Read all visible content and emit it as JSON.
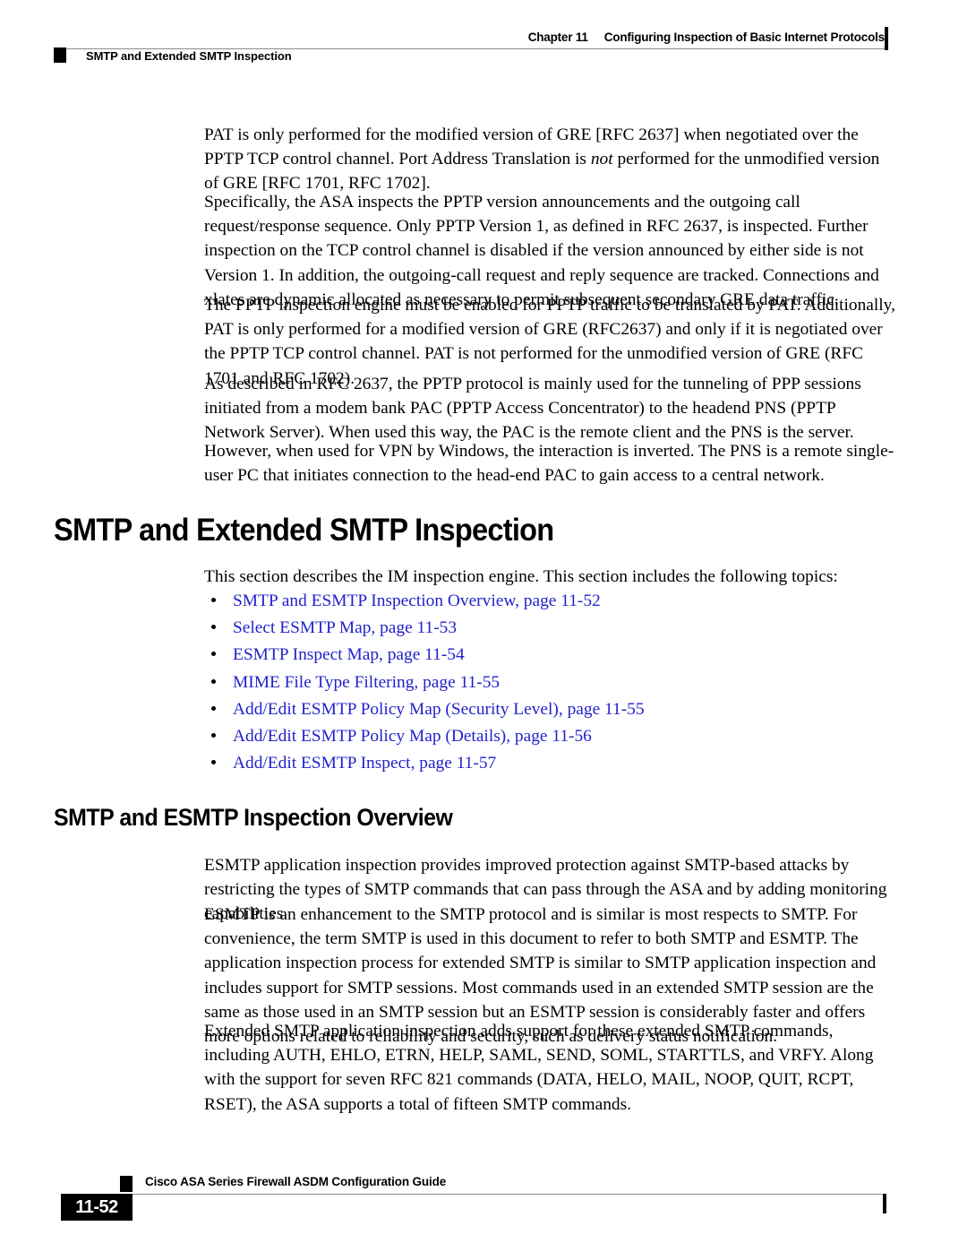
{
  "header": {
    "chapter_number": "Chapter 11",
    "chapter_title": "Configuring Inspection of Basic Internet Protocols",
    "section_name": "SMTP and Extended SMTP Inspection"
  },
  "body": {
    "paragraph_1": "PAT is only performed for the modified version of GRE [RFC 2637] when negotiated over the PPTP TCP control channel. Port Address Translation is ",
    "paragraph_1_italic": "not",
    "paragraph_1_tail": " performed for the unmodified version of GRE [RFC 1701, RFC 1702].",
    "paragraph_2": "Specifically, the ASA inspects the PPTP version announcements and the outgoing call request/response sequence. Only PPTP Version 1, as defined in RFC 2637, is inspected. Further inspection on the TCP control channel is disabled if the version announced by either side is not Version 1. In addition, the outgoing-call request and reply sequence are tracked. Connections and xlates are dynamic allocated as necessary to permit subsequent secondary GRE data traffic.",
    "paragraph_3": "The PPTP inspection engine must be enabled for PPTP traffic to be translated by PAT. Additionally, PAT is only performed for a modified version of GRE (RFC2637) and only if it is negotiated over the PPTP TCP control channel. PAT is not performed for the unmodified version of GRE (RFC 1701 and RFC 1702).",
    "paragraph_4": "As described in RFC 2637, the PPTP protocol is mainly used for the tunneling of PPP sessions initiated from a modem bank PAC (PPTP Access Concentrator) to the headend PNS (PPTP Network Server). When used this way, the PAC is the remote client and the PNS is the server.",
    "paragraph_5": "However, when used for VPN by Windows, the interaction is inverted. The PNS is a remote single-user PC that initiates connection to the head-end PAC to gain access to a central network."
  },
  "section": {
    "title": "SMTP and Extended SMTP Inspection",
    "intro": "This section describes the IM inspection engine. This section includes the following topics:",
    "topics": [
      {
        "label": "SMTP and ESMTP Inspection Overview, page 11-52"
      },
      {
        "label": "Select ESMTP Map, page 11-53"
      },
      {
        "label": "ESMTP Inspect Map, page 11-54"
      },
      {
        "label": "MIME File Type Filtering, page 11-55"
      },
      {
        "label": "Add/Edit ESMTP Policy Map (Security Level), page 11-55"
      },
      {
        "label": "Add/Edit ESMTP Policy Map (Details), page 11-56"
      },
      {
        "label": "Add/Edit ESMTP Inspect, page 11-57"
      }
    ]
  },
  "subsection": {
    "title": "SMTP and ESMTP Inspection Overview",
    "paragraph_1": "ESMTP application inspection provides improved protection against SMTP-based attacks by restricting the types of SMTP commands that can pass through the ASA and by adding monitoring capabilities.",
    "paragraph_2": "ESMTP is an enhancement to the SMTP protocol and is similar is most respects to SMTP. For convenience, the term SMTP is used in this document to refer to both SMTP and ESMTP. The application inspection process for extended SMTP is similar to SMTP application inspection and includes support for SMTP sessions. Most commands used in an extended SMTP session are the same as those used in an SMTP session but an ESMTP session is considerably faster and offers more options related to reliability and security, such as delivery status notification.",
    "paragraph_3": "Extended SMTP application inspection adds support for these extended SMTP commands, including AUTH, EHLO, ETRN, HELP, SAML, SEND, SOML, STARTTLS, and VRFY. Along with the support for seven RFC 821 commands (DATA, HELO, MAIL, NOOP, QUIT, RCPT, RSET), the ASA supports a total of fifteen SMTP commands."
  },
  "footer": {
    "guide_title": "Cisco ASA Series Firewall ASDM Configuration Guide",
    "page_number": "11-52"
  },
  "colors": {
    "link": "#2222cc",
    "rule": "#8c8c8c",
    "text": "#000000"
  }
}
